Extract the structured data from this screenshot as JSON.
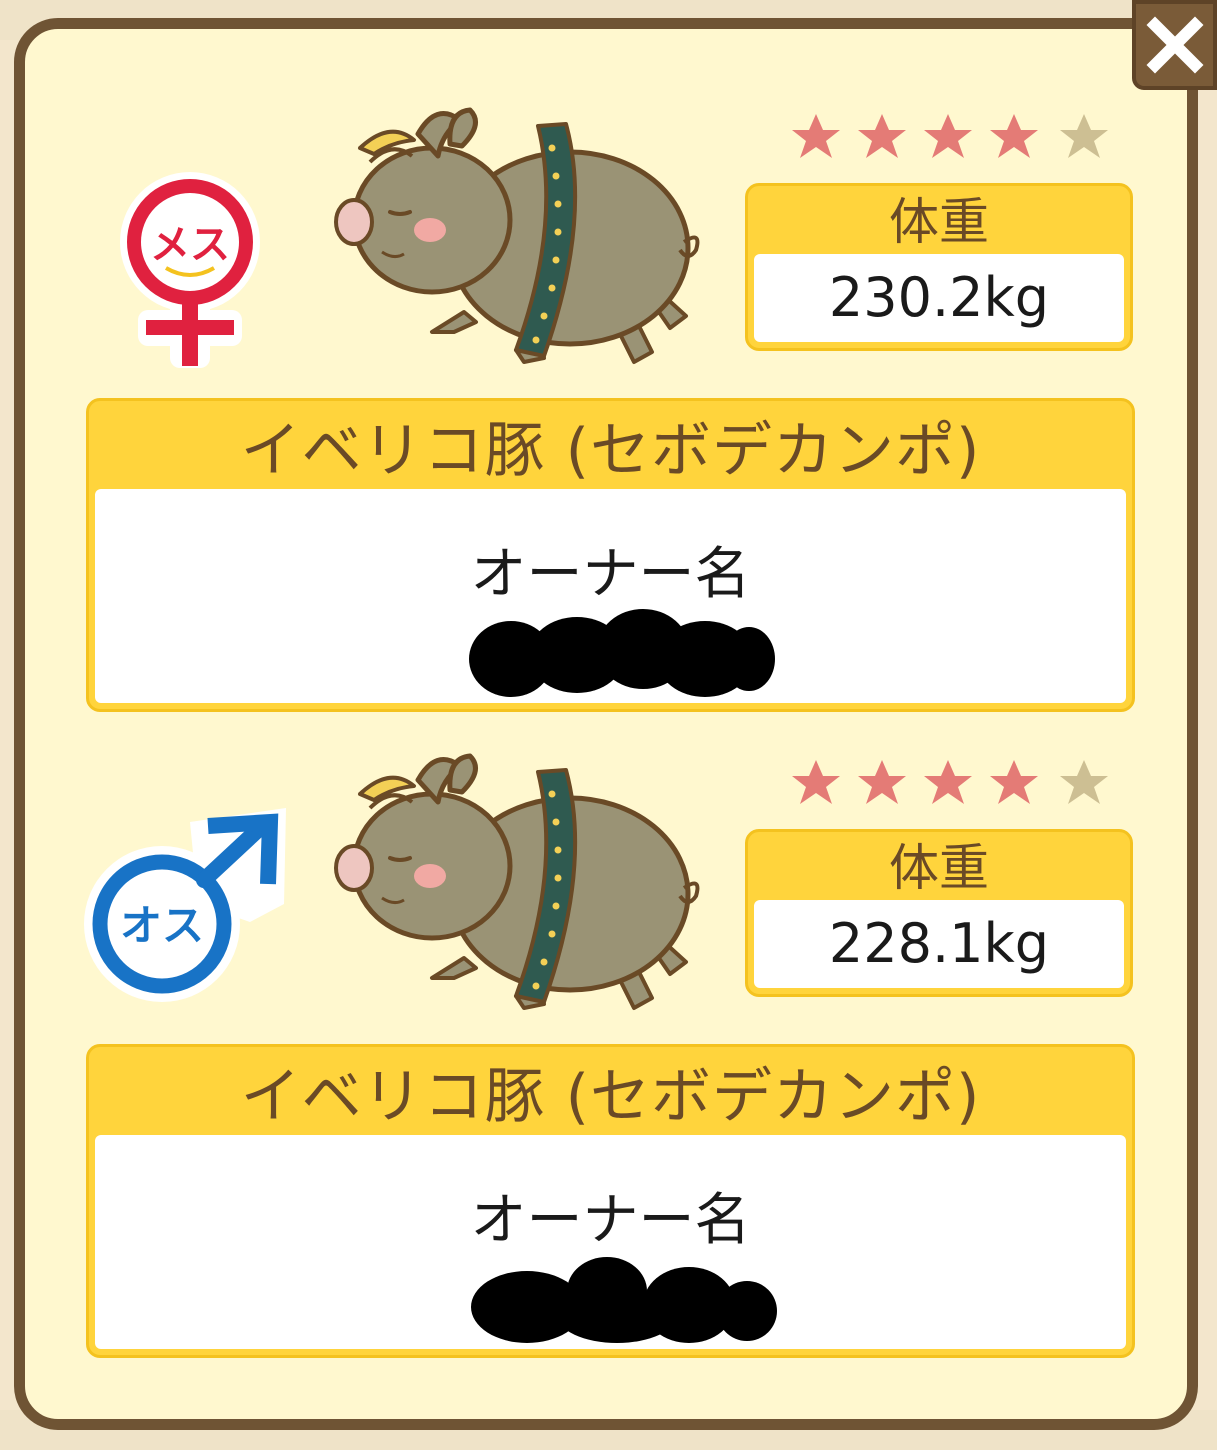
{
  "close_button": {
    "icon": "close-icon",
    "color": "#ffffff"
  },
  "pigs": [
    {
      "gender": {
        "label": "メス",
        "icon": "female-symbol-icon",
        "color": "#e0213f"
      },
      "stars": {
        "filled": 4,
        "total": 5,
        "filled_color": "#e47b76",
        "empty_color": "#cdbf93"
      },
      "weight": {
        "label": "体重",
        "value": "230.2kg"
      },
      "breed": "イベリコ豚 (セボデカンポ)",
      "owner_label": "オーナー名",
      "owner_name_redacted": true
    },
    {
      "gender": {
        "label": "オス",
        "icon": "male-symbol-icon",
        "color": "#1873c6"
      },
      "stars": {
        "filled": 4,
        "total": 5,
        "filled_color": "#e47b76",
        "empty_color": "#cdbf93"
      },
      "weight": {
        "label": "体重",
        "value": "228.1kg"
      },
      "breed": "イベリコ豚 (セボデカンポ)",
      "owner_label": "オーナー名",
      "owner_name_redacted": true
    }
  ],
  "colors": {
    "panel_border": "#6f5434",
    "panel_bg": "#fff8cf",
    "card_yellow": "#ffd43c",
    "label_brown": "#6a4a26"
  }
}
